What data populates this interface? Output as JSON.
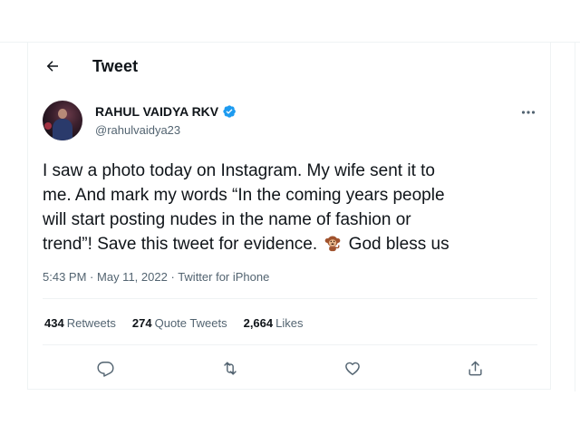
{
  "header": {
    "title": "Tweet",
    "back_icon": "arrow-left-icon"
  },
  "author": {
    "name": "RAHUL VAIDYA RKV",
    "handle": "@rahulvaidya23",
    "verified": true,
    "verified_color": "#1d9bf0"
  },
  "tweet": {
    "lines": [
      "I saw a photo today on Instagram. My wife sent it to",
      "me. And mark my words “In the coming years people",
      "will start posting nudes in the name of fashion or"
    ],
    "last_line_before_emoji": "trend”! Save this tweet for evidence.",
    "emoji": "monkey-emoji",
    "last_line_after_emoji": "God bless us"
  },
  "meta": {
    "time": "5:43 PM",
    "date": "May 11, 2022",
    "source": "Twitter for iPhone",
    "separator": "·"
  },
  "stats": {
    "retweets_count": "434",
    "retweets_label": "Retweets",
    "quotes_count": "274",
    "quotes_label": "Quote Tweets",
    "likes_count": "2,664",
    "likes_label": "Likes"
  },
  "actions": {
    "reply_icon": "reply-icon",
    "retweet_icon": "retweet-icon",
    "like_icon": "heart-icon",
    "share_icon": "share-icon"
  },
  "colors": {
    "text": "#0f1419",
    "secondary": "#536471",
    "border": "#eff3f4"
  }
}
